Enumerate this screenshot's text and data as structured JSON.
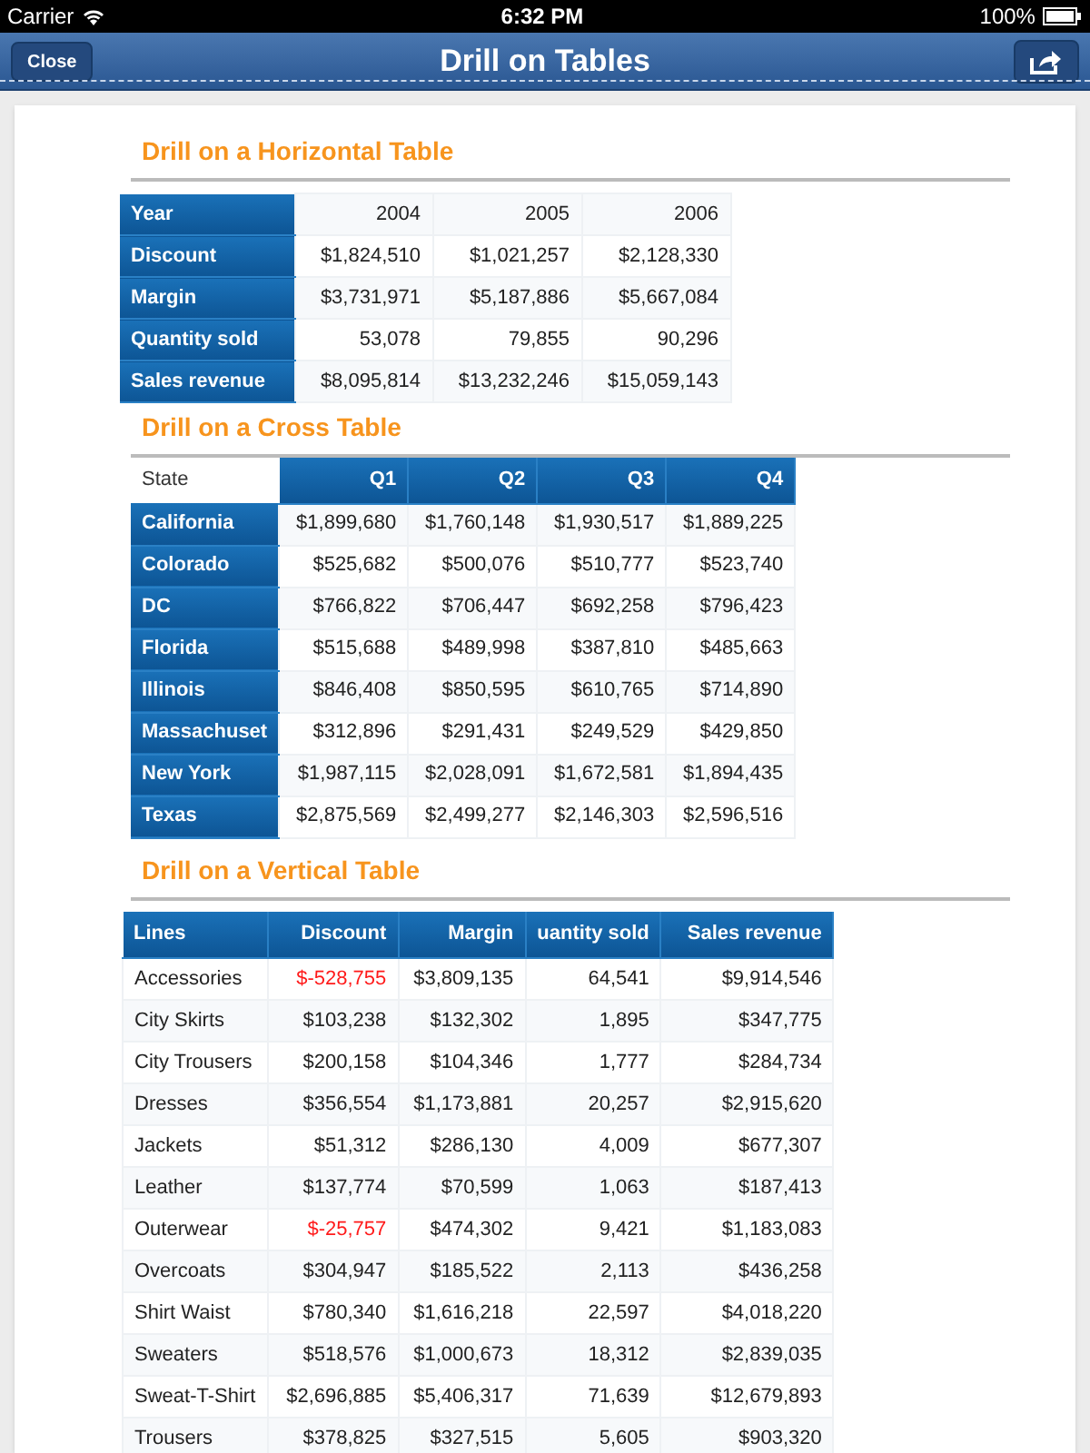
{
  "status_bar": {
    "carrier": "Carrier",
    "time": "6:32 PM",
    "battery": "100%"
  },
  "nav_bar": {
    "title": "Drill on Tables",
    "close_button": "Close"
  },
  "horizontal_table": {
    "heading": "Drill on a Horizontal Table",
    "rows": [
      {
        "label": "Year",
        "cells": [
          "2004",
          "2005",
          "2006"
        ]
      },
      {
        "label": "Discount",
        "cells": [
          "$1,824,510",
          "$1,021,257",
          "$2,128,330"
        ]
      },
      {
        "label": "Margin",
        "cells": [
          "$3,731,971",
          "$5,187,886",
          "$5,667,084"
        ]
      },
      {
        "label": "Quantity sold",
        "cells": [
          "53,078",
          "79,855",
          "90,296"
        ]
      },
      {
        "label": "Sales revenue",
        "cells": [
          "$8,095,814",
          "$13,232,246",
          "$15,059,143"
        ]
      }
    ]
  },
  "cross_table": {
    "heading": "Drill on a Cross Table",
    "corner": "State",
    "columns": [
      "Q1",
      "Q2",
      "Q3",
      "Q4"
    ],
    "rows": [
      {
        "label": "California",
        "cells": [
          "$1,899,680",
          "$1,760,148",
          "$1,930,517",
          "$1,889,225"
        ]
      },
      {
        "label": "Colorado",
        "cells": [
          "$525,682",
          "$500,076",
          "$510,777",
          "$523,740"
        ]
      },
      {
        "label": "DC",
        "cells": [
          "$766,822",
          "$706,447",
          "$692,258",
          "$796,423"
        ]
      },
      {
        "label": "Florida",
        "cells": [
          "$515,688",
          "$489,998",
          "$387,810",
          "$485,663"
        ]
      },
      {
        "label": "Illinois",
        "cells": [
          "$846,408",
          "$850,595",
          "$610,765",
          "$714,890"
        ]
      },
      {
        "label": "Massachuset",
        "cells": [
          "$312,896",
          "$291,431",
          "$249,529",
          "$429,850"
        ]
      },
      {
        "label": "New York",
        "cells": [
          "$1,987,115",
          "$2,028,091",
          "$1,672,581",
          "$1,894,435"
        ]
      },
      {
        "label": "Texas",
        "cells": [
          "$2,875,569",
          "$2,499,277",
          "$2,146,303",
          "$2,596,516"
        ]
      }
    ]
  },
  "vertical_table": {
    "heading": "Drill on a Vertical Table",
    "columns": [
      "Lines",
      "Discount",
      "Margin",
      "uantity sold",
      "Sales revenue"
    ],
    "rows": [
      {
        "cells": [
          "Accessories",
          "$-528,755",
          "$3,809,135",
          "64,541",
          "$9,914,546"
        ],
        "discount_negative": true
      },
      {
        "cells": [
          "City Skirts",
          "$103,238",
          "$132,302",
          "1,895",
          "$347,775"
        ],
        "discount_negative": false
      },
      {
        "cells": [
          "City Trousers",
          "$200,158",
          "$104,346",
          "1,777",
          "$284,734"
        ],
        "discount_negative": false
      },
      {
        "cells": [
          "Dresses",
          "$356,554",
          "$1,173,881",
          "20,257",
          "$2,915,620"
        ],
        "discount_negative": false
      },
      {
        "cells": [
          "Jackets",
          "$51,312",
          "$286,130",
          "4,009",
          "$677,307"
        ],
        "discount_negative": false
      },
      {
        "cells": [
          "Leather",
          "$137,774",
          "$70,599",
          "1,063",
          "$187,413"
        ],
        "discount_negative": false
      },
      {
        "cells": [
          "Outerwear",
          "$-25,757",
          "$474,302",
          "9,421",
          "$1,183,083"
        ],
        "discount_negative": true
      },
      {
        "cells": [
          "Overcoats",
          "$304,947",
          "$185,522",
          "2,113",
          "$436,258"
        ],
        "discount_negative": false
      },
      {
        "cells": [
          "Shirt Waist",
          "$780,340",
          "$1,616,218",
          "22,597",
          "$4,018,220"
        ],
        "discount_negative": false
      },
      {
        "cells": [
          "Sweaters",
          "$518,576",
          "$1,000,673",
          "18,312",
          "$2,839,035"
        ],
        "discount_negative": false
      },
      {
        "cells": [
          "Sweat-T-Shirt",
          "$2,696,885",
          "$5,406,317",
          "71,639",
          "$12,679,893"
        ],
        "discount_negative": false
      },
      {
        "cells": [
          "Trousers",
          "$378,825",
          "$327,515",
          "5,605",
          "$903,320"
        ],
        "discount_negative": false
      }
    ]
  }
}
